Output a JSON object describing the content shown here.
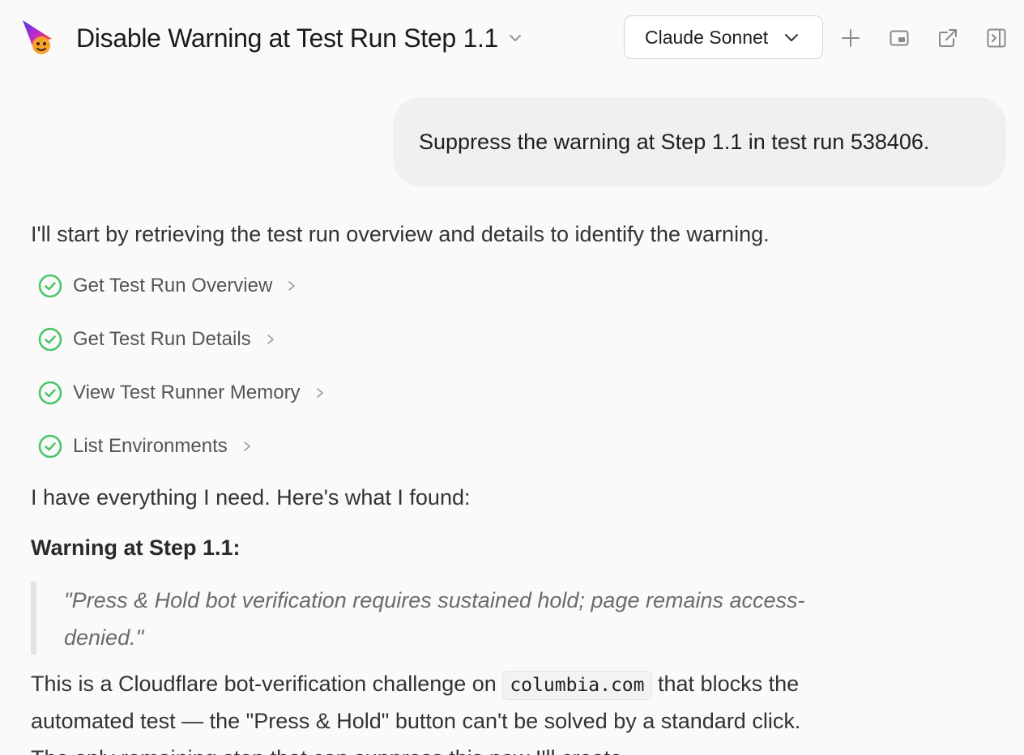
{
  "header": {
    "title": "Disable Warning at Test Run Step 1.1",
    "model": "Claude Sonnet"
  },
  "user_message": "Suppress the warning at Step 1.1 in test run 538406.",
  "assistant": {
    "intro": "I'll start by retrieving the test run overview and details to identify the warning.",
    "tools": [
      {
        "label": "Get Test Run Overview",
        "status": "done"
      },
      {
        "label": "Get Test Run Details",
        "status": "done"
      },
      {
        "label": "View Test Runner Memory",
        "status": "done"
      },
      {
        "label": "List Environments",
        "status": "done"
      }
    ],
    "found": "I have everything I need. Here's what I found:",
    "warning_heading": "Warning at Step 1.1:",
    "quote_line1": "\"Press & Hold bot verification requires sustained hold; page remains access-",
    "quote_line2": "denied.\"",
    "para_part1": "This is a Cloudflare bot-verification challenge on",
    "para_code": "columbia.com",
    "para_part2": "that blocks the",
    "para_line2": "automated test — the \"Press & Hold\" button can't be solved by a standard click.",
    "para_line3": "The only remaining step that can suppress this now I'll create"
  },
  "colors": {
    "success": "#4cc56b",
    "background": "#fafafa",
    "bubble": "#f0f0f0"
  }
}
